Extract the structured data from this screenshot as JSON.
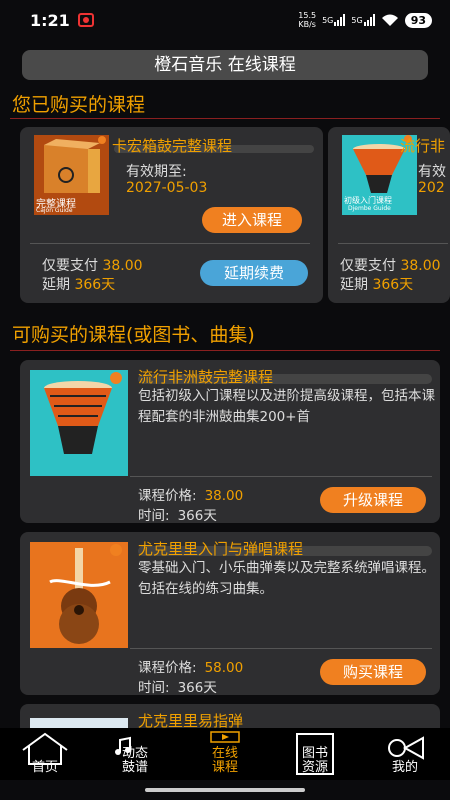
{
  "status": {
    "time": "1:21",
    "net_speed_top": "15.5",
    "net_speed_unit": "KB/s",
    "sig1": "5G",
    "sig2": "5G",
    "battery": "93"
  },
  "header": {
    "title": "橙石音乐 在线课程"
  },
  "purchased": {
    "section_title": "您已购买的课程",
    "cards": [
      {
        "title": "卡宏箱鼓完整课程",
        "cover_label": "完整课程",
        "cover_sub": "Cajon Guide",
        "valid_label": "有效期至:",
        "valid_date": "2027-05-03",
        "enter_btn": "进入课程",
        "paid_label": "仅要支付",
        "paid_value": "38.00",
        "extend_label": "延期",
        "extend_days": "366天",
        "extend_btn": "延期续费"
      },
      {
        "title": "流行非",
        "cover_label": "初级入门课程",
        "cover_sub": "Djembe Guide",
        "valid_label": "有效",
        "valid_date": "202",
        "paid_label": "仅要支付",
        "paid_value": "38.00",
        "extend_label": "延期",
        "extend_days": "366天"
      }
    ]
  },
  "buyable": {
    "section_title": "可购买的课程(或图书、曲集)",
    "courses": [
      {
        "title": "流行非洲鼓完整课程",
        "desc": "包括初级入门课程以及进阶提高级课程，包括本课程配套的非洲鼓曲集200+首",
        "price_label": "课程价格:",
        "price": "38.00",
        "time_label": "时间:",
        "time": "366天",
        "button": "升级课程"
      },
      {
        "title": "尤克里里入门与弹唱课程",
        "desc": "零基础入门、小乐曲弹奏以及完整系统弹唱课程。包括在线的练习曲集。",
        "price_label": "课程价格:",
        "price": "58.00",
        "time_label": "时间:",
        "time": "366天",
        "button": "购买课程"
      },
      {
        "title": "尤克里里易指弹"
      }
    ]
  },
  "tabs": [
    {
      "label": "首页"
    },
    {
      "label_line1": "动态",
      "label_line2": "鼓谱"
    },
    {
      "label_line1": "在线",
      "label_line2": "课程"
    },
    {
      "label_line1": "图书",
      "label_line2": "资源"
    },
    {
      "label": "我的"
    }
  ],
  "colors": {
    "accent": "#f0a000",
    "button_orange": "#f08020",
    "button_blue": "#4aa5d8",
    "card_bg": "#2e2e30",
    "background": "#0b0b0d"
  }
}
